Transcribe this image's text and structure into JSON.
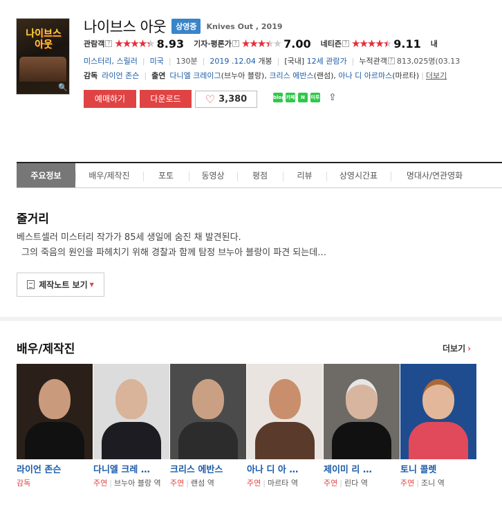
{
  "movie": {
    "poster_title": "나이브스 아웃",
    "title": "나이브스 아웃",
    "status_badge": "상영중",
    "original_title": "Knives Out , 2019"
  },
  "ratings": [
    {
      "label": "관람객",
      "score": "8.93",
      "stars_fraction": 0.89
    },
    {
      "label": "기자·평론가",
      "score": "7.00",
      "stars_fraction": 0.7
    },
    {
      "label": "네티즌",
      "score": "9.11",
      "stars_fraction": 0.91
    },
    {
      "label": "내"
    }
  ],
  "info": {
    "genre": "미스터리, 스릴러",
    "country": "미국",
    "runtime": "130분",
    "release_date": "2019 .12.04",
    "release_label": "개봉",
    "rating_prefix": "[국내]",
    "rating": "12세 관람가",
    "audience_label": "누적관객",
    "audience": "813,025명",
    "audience_date": "(03.13"
  },
  "crew": {
    "director_label": "감독",
    "director": "라이언 존슨",
    "cast_label": "출연",
    "cast_1": "다니엘 크레이그",
    "cast_1_role": "(브누아 블랑)",
    "cast_2": "크리스 에반스",
    "cast_2_role": "(랜섬)",
    "cast_3": "아나 디 아르마스",
    "cast_3_role": "(마르타)",
    "more": "더보기"
  },
  "buttons": {
    "reserve": "예매하기",
    "download": "다운로드",
    "like_count": "3,380"
  },
  "share": [
    "blog",
    "카페",
    "N",
    "미투"
  ],
  "tabs": [
    "주요정보",
    "배우/제작진",
    "포토",
    "동영상",
    "평점",
    "리뷰",
    "상영시간표",
    "명대사/연관영화"
  ],
  "synopsis": {
    "heading": "줄거리",
    "line1": "베스트셀러 미스터리 작가가 85세 생일에 숨진 채 발견된다.",
    "line2": "그의 죽음의 원인을 파헤치기 위해 경찰과 함께 탐정 브누아 블랑이 파견 되는데…",
    "note_button": "제작노트 보기"
  },
  "cast_section": {
    "heading": "배우/제작진",
    "more": "더보기",
    "people": [
      {
        "name": "라이언 존슨",
        "role": "감독",
        "character": ""
      },
      {
        "name": "다니엘 크레 …",
        "role": "주연",
        "character": "브누아 블랑 역"
      },
      {
        "name": "크리스 에반스",
        "role": "주연",
        "character": "랜섬 역"
      },
      {
        "name": "아나 디 아 …",
        "role": "주연",
        "character": "마르타 역"
      },
      {
        "name": "제이미 리 …",
        "role": "주연",
        "character": "린다 역"
      },
      {
        "name": "토니 콜렛",
        "role": "주연",
        "character": "조니 역"
      }
    ]
  }
}
